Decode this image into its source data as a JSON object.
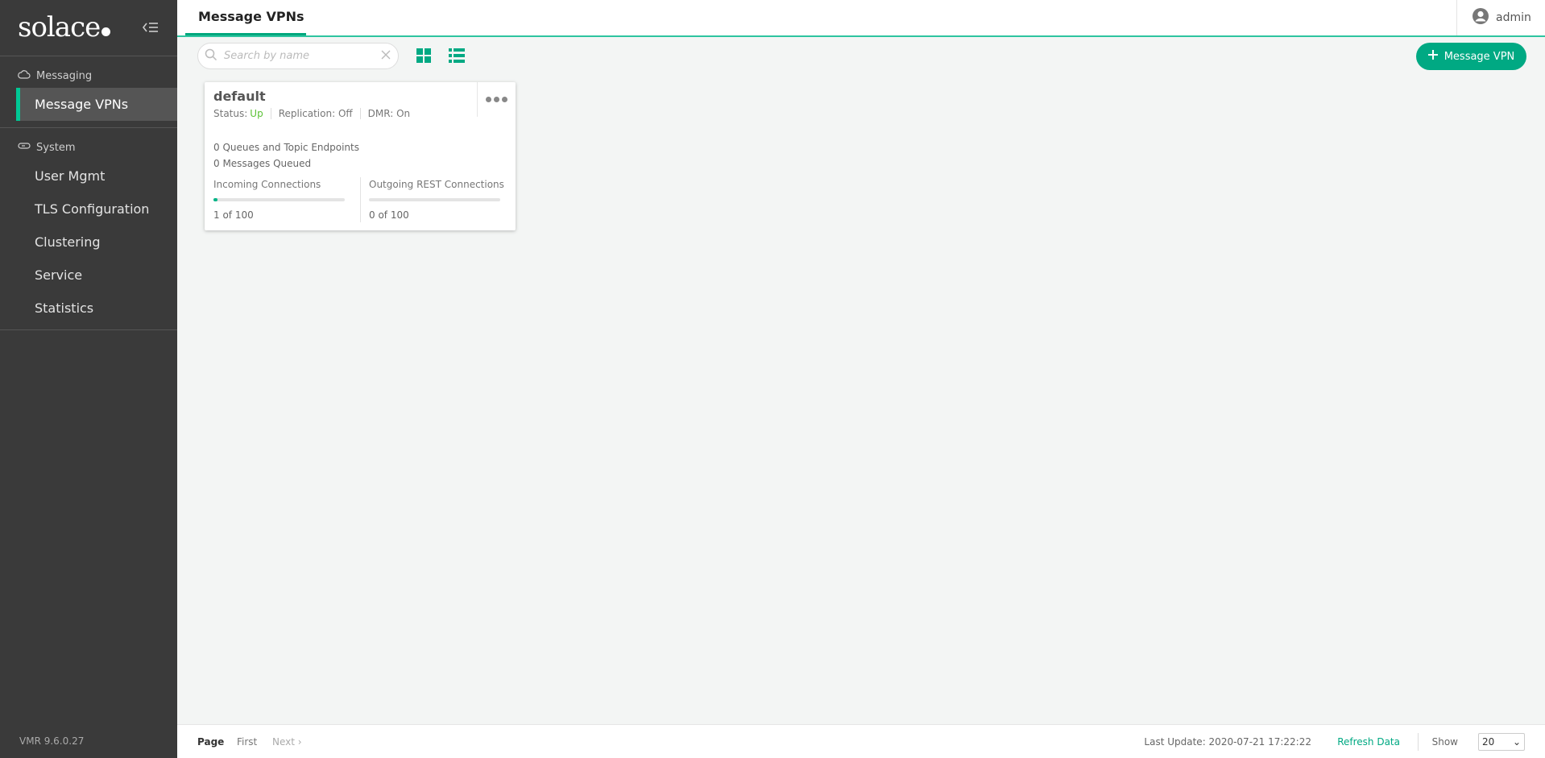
{
  "sidebar": {
    "logo": "solace",
    "sections": [
      {
        "label": "Messaging",
        "items": [
          {
            "label": "Message VPNs",
            "active": true
          }
        ]
      },
      {
        "label": "System",
        "items": [
          {
            "label": "User Mgmt"
          },
          {
            "label": "TLS Configuration"
          },
          {
            "label": "Clustering"
          },
          {
            "label": "Service"
          },
          {
            "label": "Statistics"
          }
        ]
      }
    ],
    "version": "VMR 9.6.0.27"
  },
  "header": {
    "tab": "Message VPNs",
    "user": "admin"
  },
  "toolbar": {
    "search_placeholder": "Search by name",
    "add_label": "Message VPN"
  },
  "card": {
    "title": "default",
    "status_label": "Status:",
    "status_value": "Up",
    "replication": "Replication: Off",
    "dmr": "DMR: On",
    "queues": "0 Queues and Topic Endpoints",
    "messages": "0 Messages Queued",
    "incoming_label": "Incoming Connections",
    "incoming_count": "1 of 100",
    "incoming_fraction": 0.01,
    "outgoing_label": "Outgoing REST Connections",
    "outgoing_count": "0 of 100",
    "outgoing_fraction": 0.0
  },
  "footer": {
    "page": "Page",
    "first": "First",
    "next": "Next",
    "last_update": "Last Update: 2020-07-21 17:22:22",
    "refresh": "Refresh Data",
    "show": "Show",
    "page_size": "20"
  },
  "colors": {
    "accent": "#00a983",
    "status_up": "#5cc236",
    "sidebar_bg": "#3a3a3a"
  }
}
